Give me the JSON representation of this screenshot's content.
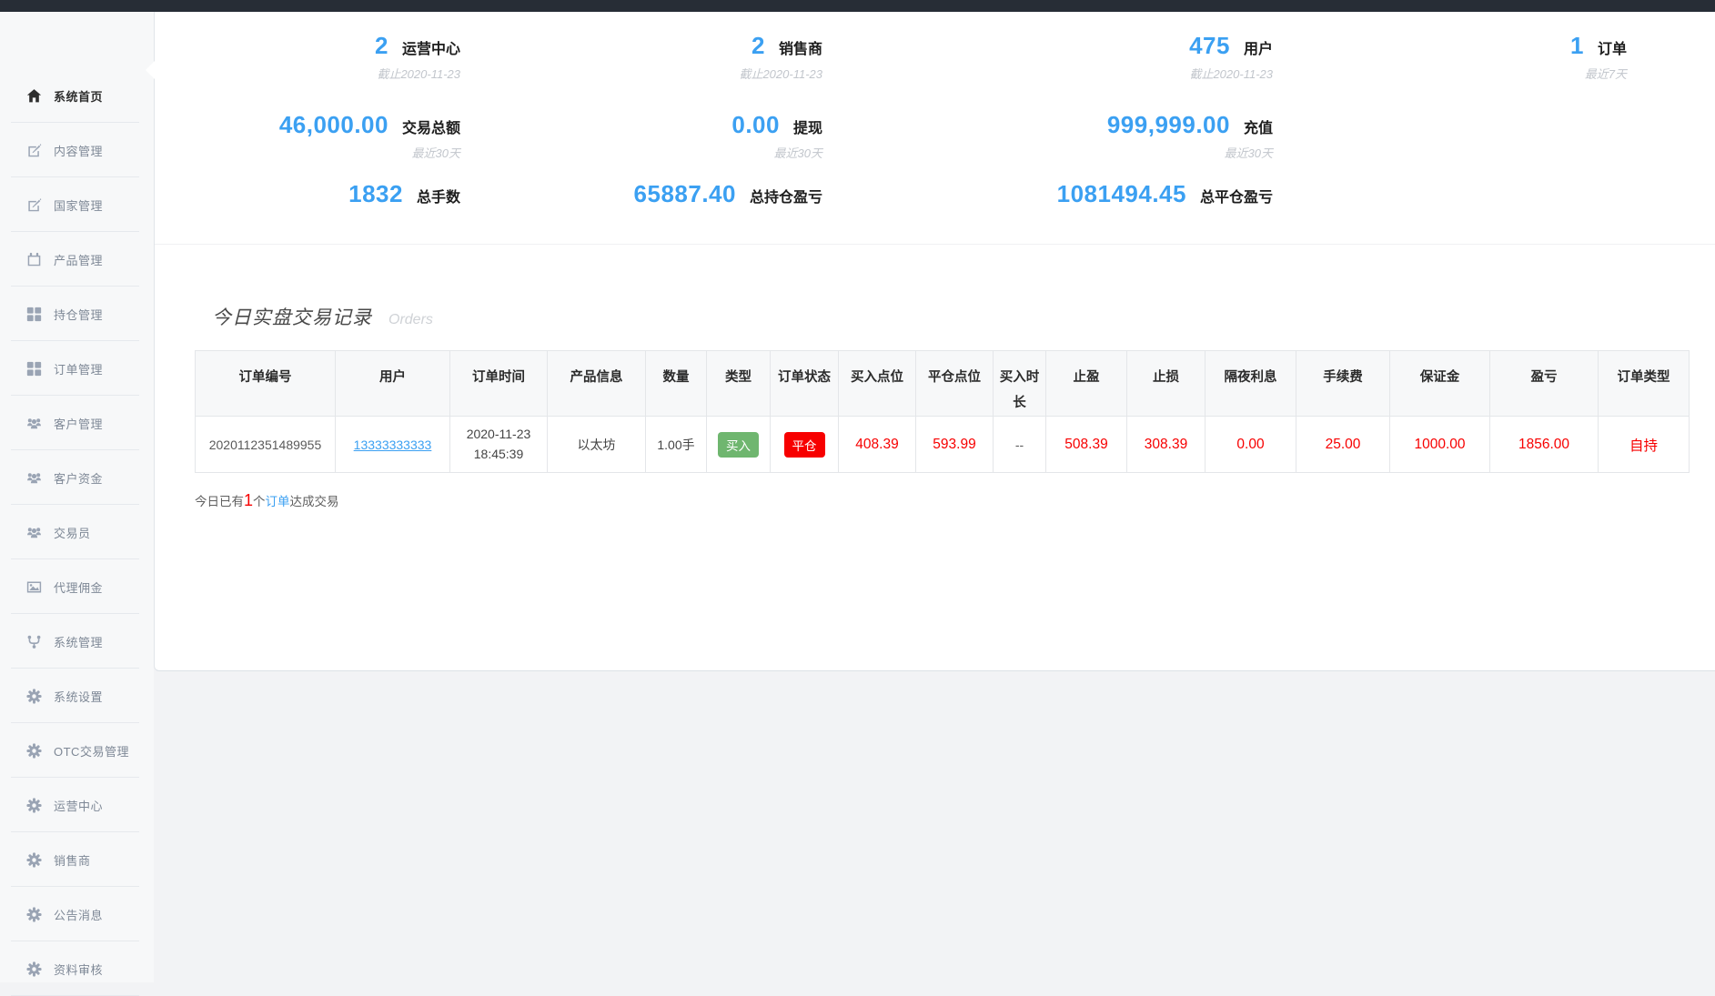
{
  "sidebar": {
    "items": [
      {
        "label": "系统首页",
        "icon": "home",
        "active": true
      },
      {
        "label": "内容管理",
        "icon": "edit",
        "active": false
      },
      {
        "label": "国家管理",
        "icon": "edit",
        "active": false
      },
      {
        "label": "产品管理",
        "icon": "calendar",
        "active": false
      },
      {
        "label": "持仓管理",
        "icon": "grid",
        "active": false
      },
      {
        "label": "订单管理",
        "icon": "grid",
        "active": false
      },
      {
        "label": "客户管理",
        "icon": "users",
        "active": false
      },
      {
        "label": "客户资金",
        "icon": "users",
        "active": false
      },
      {
        "label": "交易员",
        "icon": "users",
        "active": false
      },
      {
        "label": "代理佣金",
        "icon": "image",
        "active": false
      },
      {
        "label": "系统管理",
        "icon": "branch",
        "active": false
      },
      {
        "label": "系统设置",
        "icon": "gear",
        "active": false
      },
      {
        "label": "OTC交易管理",
        "icon": "gear",
        "active": false
      },
      {
        "label": "运营中心",
        "icon": "gear",
        "active": false
      },
      {
        "label": "销售商",
        "icon": "gear",
        "active": false
      },
      {
        "label": "公告消息",
        "icon": "gear",
        "active": false
      },
      {
        "label": "资料审核",
        "icon": "gear",
        "active": false
      }
    ]
  },
  "stats": {
    "col1": [
      {
        "value": "2",
        "label": "运营中心",
        "note": "截止2020-11-23"
      },
      {
        "value": "46,000.00",
        "label": "交易总额",
        "note": "最近30天"
      },
      {
        "value": "1832",
        "label": "总手数",
        "note": ""
      }
    ],
    "col2": [
      {
        "value": "2",
        "label": "销售商",
        "note": "截止2020-11-23"
      },
      {
        "value": "0.00",
        "label": "提现",
        "note": "最近30天"
      },
      {
        "value": "65887.40",
        "label": "总持仓盈亏",
        "note": ""
      }
    ],
    "col3": [
      {
        "value": "475",
        "label": "用户",
        "note": "截止2020-11-23"
      },
      {
        "value": "999,999.00",
        "label": "充值",
        "note": "最近30天"
      },
      {
        "value": "1081494.45",
        "label": "总平仓盈亏",
        "note": ""
      }
    ],
    "col4": [
      {
        "value": "1",
        "label": "订单",
        "note": "最近7天"
      }
    ]
  },
  "orders": {
    "title": "今日实盘交易记录",
    "subtitle": "Orders",
    "columns": [
      "订单编号",
      "用户",
      "订单时间",
      "产品信息",
      "数量",
      "类型",
      "订单状态",
      "买入点位",
      "平仓点位",
      "买入时长",
      "止盈",
      "止损",
      "隔夜利息",
      "手续费",
      "保证金",
      "盈亏",
      "订单类型"
    ],
    "row": {
      "order_no": "2020112351489955",
      "user": "13333333333",
      "time_line1": "2020-11-23",
      "time_line2": "18:45:39",
      "product": "以太坊",
      "quantity": "1.00手",
      "type": "买入",
      "status": "平仓",
      "buy_point": "408.39",
      "close_point": "593.99",
      "buy_duration": "--",
      "take_profit": "508.39",
      "stop_loss": "308.39",
      "overnight_interest": "0.00",
      "fee": "25.00",
      "margin": "1000.00",
      "profit": "1856.00",
      "order_type": "自持"
    },
    "note": {
      "prefix": "今日已有",
      "count": "1",
      "unit": "个",
      "link": "订单",
      "suffix": "达成交易"
    }
  },
  "colors": {
    "accent_blue": "#3ba0f2",
    "value_red": "#f70000",
    "badge_green": "#6fb66f",
    "topbar_dark": "#272d36"
  }
}
